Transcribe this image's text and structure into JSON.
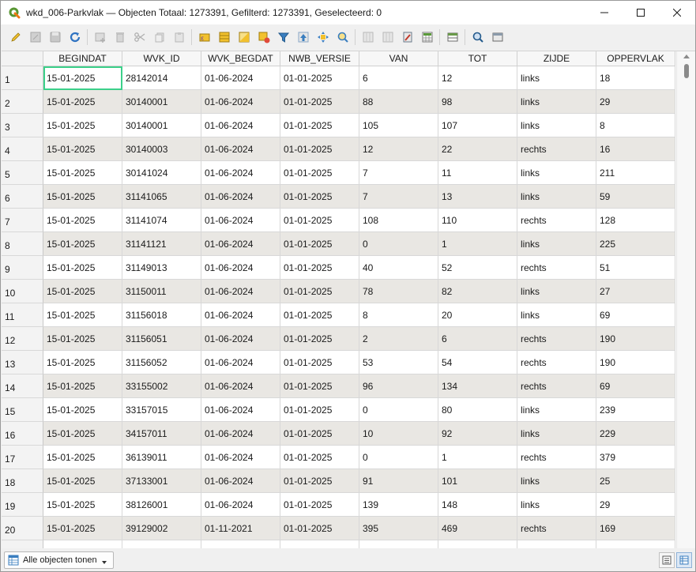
{
  "window": {
    "title": "wkd_006-Parkvlak — Objecten Totaal: 1273391, Gefilterd: 1273391, Geselecteerd: 0"
  },
  "toolbar": {
    "buttons": [
      "pencil-icon",
      "save-edits-icon",
      "save-icon",
      "reload-icon",
      "add-feature-icon",
      "delete-feature-icon",
      "cut-icon",
      "copy-icon",
      "paste-icon",
      "expression-select-icon",
      "select-all-icon",
      "invert-selection-icon",
      "deselect-icon",
      "filter-selected-icon",
      "move-selection-top-icon",
      "pan-to-selection-icon",
      "zoom-to-selection-icon",
      "new-field-icon",
      "delete-field-icon",
      "field-calculator-icon",
      "conditional-formatting-icon",
      "dock-table-icon",
      "zoom-map-icon",
      "actions-icon"
    ]
  },
  "table": {
    "columns": [
      "BEGINDAT",
      "WVK_ID",
      "WVK_BEGDAT",
      "NWB_VERSIE",
      "VAN",
      "TOT",
      "ZIJDE",
      "OPPERVLAK"
    ],
    "rows": [
      {
        "n": "1",
        "cells": [
          "15-01-2025",
          "28142014",
          "01-06-2024",
          "01-01-2025",
          "6",
          "12",
          "links",
          "18"
        ]
      },
      {
        "n": "2",
        "cells": [
          "15-01-2025",
          "30140001",
          "01-06-2024",
          "01-01-2025",
          "88",
          "98",
          "links",
          "29"
        ]
      },
      {
        "n": "3",
        "cells": [
          "15-01-2025",
          "30140001",
          "01-06-2024",
          "01-01-2025",
          "105",
          "107",
          "links",
          "8"
        ]
      },
      {
        "n": "4",
        "cells": [
          "15-01-2025",
          "30140003",
          "01-06-2024",
          "01-01-2025",
          "12",
          "22",
          "rechts",
          "16"
        ]
      },
      {
        "n": "5",
        "cells": [
          "15-01-2025",
          "30141024",
          "01-06-2024",
          "01-01-2025",
          "7",
          "11",
          "links",
          "211"
        ]
      },
      {
        "n": "6",
        "cells": [
          "15-01-2025",
          "31141065",
          "01-06-2024",
          "01-01-2025",
          "7",
          "13",
          "links",
          "59"
        ]
      },
      {
        "n": "7",
        "cells": [
          "15-01-2025",
          "31141074",
          "01-06-2024",
          "01-01-2025",
          "108",
          "110",
          "rechts",
          "128"
        ]
      },
      {
        "n": "8",
        "cells": [
          "15-01-2025",
          "31141121",
          "01-06-2024",
          "01-01-2025",
          "0",
          "1",
          "links",
          "225"
        ]
      },
      {
        "n": "9",
        "cells": [
          "15-01-2025",
          "31149013",
          "01-06-2024",
          "01-01-2025",
          "40",
          "52",
          "rechts",
          "51"
        ]
      },
      {
        "n": "10",
        "cells": [
          "15-01-2025",
          "31150011",
          "01-06-2024",
          "01-01-2025",
          "78",
          "82",
          "links",
          "27"
        ]
      },
      {
        "n": "11",
        "cells": [
          "15-01-2025",
          "31156018",
          "01-06-2024",
          "01-01-2025",
          "8",
          "20",
          "links",
          "69"
        ]
      },
      {
        "n": "12",
        "cells": [
          "15-01-2025",
          "31156051",
          "01-06-2024",
          "01-01-2025",
          "2",
          "6",
          "rechts",
          "190"
        ]
      },
      {
        "n": "13",
        "cells": [
          "15-01-2025",
          "31156052",
          "01-06-2024",
          "01-01-2025",
          "53",
          "54",
          "rechts",
          "190"
        ]
      },
      {
        "n": "14",
        "cells": [
          "15-01-2025",
          "33155002",
          "01-06-2024",
          "01-01-2025",
          "96",
          "134",
          "rechts",
          "69"
        ]
      },
      {
        "n": "15",
        "cells": [
          "15-01-2025",
          "33157015",
          "01-06-2024",
          "01-01-2025",
          "0",
          "80",
          "links",
          "239"
        ]
      },
      {
        "n": "16",
        "cells": [
          "15-01-2025",
          "34157011",
          "01-06-2024",
          "01-01-2025",
          "10",
          "92",
          "links",
          "229"
        ]
      },
      {
        "n": "17",
        "cells": [
          "15-01-2025",
          "36139011",
          "01-06-2024",
          "01-01-2025",
          "0",
          "1",
          "rechts",
          "379"
        ]
      },
      {
        "n": "18",
        "cells": [
          "15-01-2025",
          "37133001",
          "01-06-2024",
          "01-01-2025",
          "91",
          "101",
          "links",
          "25"
        ]
      },
      {
        "n": "19",
        "cells": [
          "15-01-2025",
          "38126001",
          "01-06-2024",
          "01-01-2025",
          "139",
          "148",
          "links",
          "29"
        ]
      },
      {
        "n": "20",
        "cells": [
          "15-01-2025",
          "39129002",
          "01-11-2021",
          "01-01-2025",
          "395",
          "469",
          "rechts",
          "169"
        ]
      }
    ]
  },
  "statusbar": {
    "filter_button_label": "Alle objecten tonen"
  },
  "colors": {
    "row_alt": "#e9e7e3",
    "focus": "#3cd08a",
    "accent": "#3a7ebf"
  }
}
